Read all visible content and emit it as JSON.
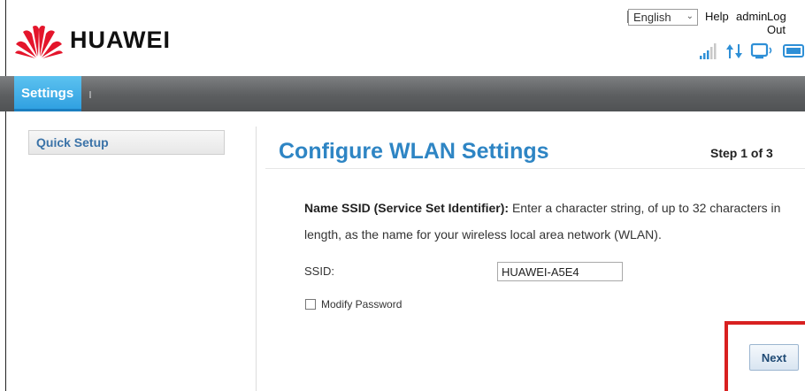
{
  "header": {
    "brand": "HUAWEI",
    "language": "English",
    "help_label": "Help",
    "user_label": "admin",
    "logout_label": "Log Out",
    "brand_color": "#e4152b"
  },
  "nav": {
    "tabs": [
      {
        "label": "Settings",
        "active": true
      }
    ]
  },
  "sidebar": {
    "items": [
      {
        "label": "Quick Setup"
      }
    ]
  },
  "main": {
    "title": "Configure WLAN Settings",
    "step": "Step 1 of 3",
    "description_bold": "Name SSID (Service Set Identifier):",
    "description_text": " Enter a character string, of up to 32 characters in length, as the name for your wireless local area network (WLAN).",
    "ssid_label": "SSID:",
    "ssid_value": "HUAWEI-A5E4",
    "modify_password_label": "Modify Password",
    "modify_password_checked": false,
    "next_label": "Next"
  },
  "status_icons": [
    "signal-icon",
    "data-transfer-icon",
    "wifi-monitor-icon",
    "battery-icon"
  ],
  "colors": {
    "accent": "#2e85c4",
    "tab_active": "#2d9ee0",
    "highlight": "#d82020"
  }
}
